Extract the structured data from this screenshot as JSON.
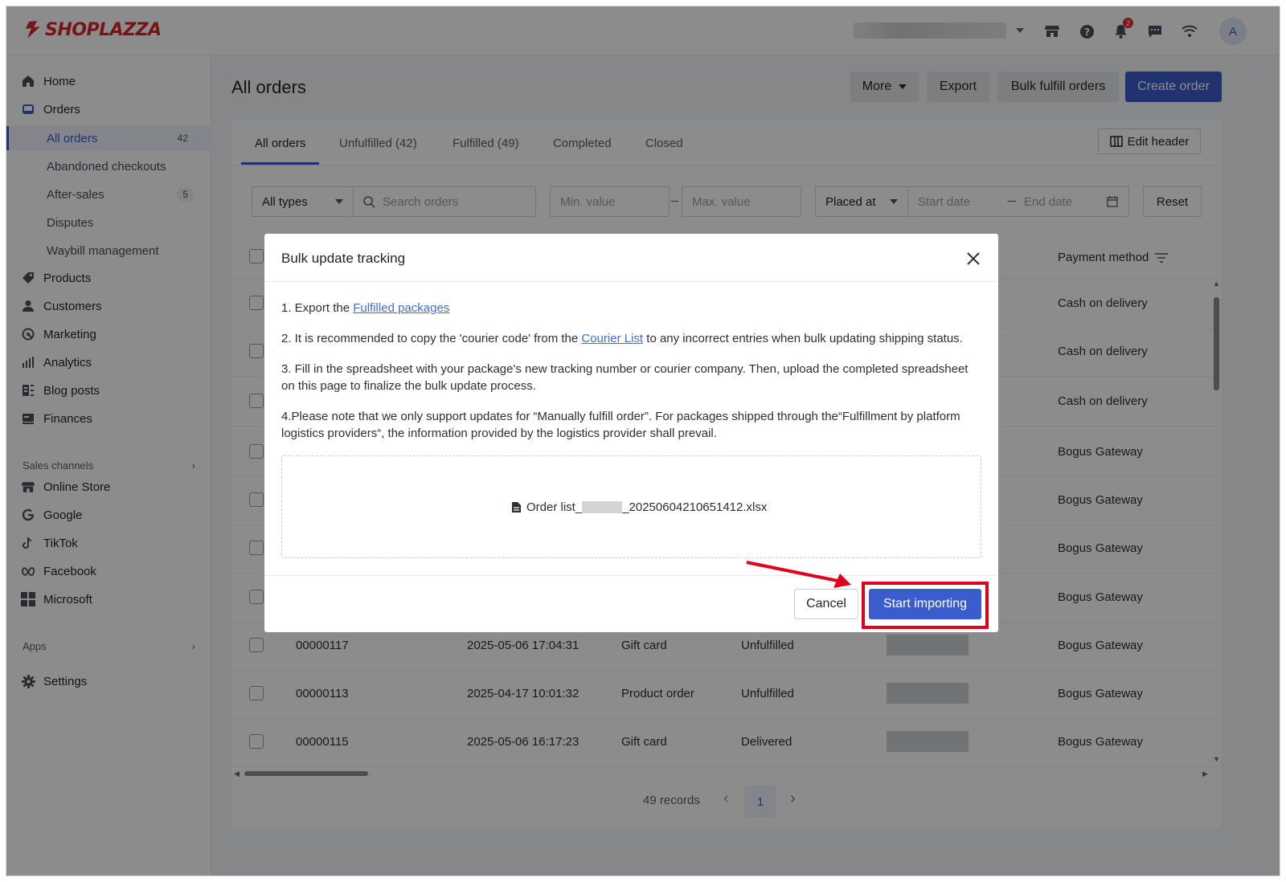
{
  "brand": {
    "name": "SHOPLAZZA",
    "color": "#d7262c",
    "accent": "#3b5ccc"
  },
  "topbar": {
    "icons": [
      "store-icon",
      "help-icon",
      "bell-icon",
      "chat-icon",
      "wifi-icon"
    ],
    "notification_count": "2",
    "avatar_letter": "A"
  },
  "sidebar": {
    "items": [
      {
        "label": "Home",
        "icon": "home-icon"
      },
      {
        "label": "Orders",
        "icon": "orders-icon"
      },
      {
        "label": "Products",
        "icon": "tag-icon"
      },
      {
        "label": "Customers",
        "icon": "user-icon"
      },
      {
        "label": "Marketing",
        "icon": "marketing-icon"
      },
      {
        "label": "Analytics",
        "icon": "bar-chart-icon"
      },
      {
        "label": "Blog posts",
        "icon": "blog-icon"
      },
      {
        "label": "Finances",
        "icon": "finance-icon"
      }
    ],
    "order_subitems": [
      {
        "label": "All orders",
        "count": "42"
      },
      {
        "label": "Abandoned checkouts",
        "count": ""
      },
      {
        "label": "After-sales",
        "count": "5"
      },
      {
        "label": "Disputes",
        "count": ""
      },
      {
        "label": "Waybill management",
        "count": ""
      }
    ],
    "sales_channels_label": "Sales channels",
    "channels": [
      {
        "label": "Online Store",
        "icon": "store-icon"
      },
      {
        "label": "Google",
        "icon": "google-icon"
      },
      {
        "label": "TikTok",
        "icon": "tiktok-icon"
      },
      {
        "label": "Facebook",
        "icon": "meta-icon"
      },
      {
        "label": "Microsoft",
        "icon": "microsoft-icon"
      }
    ],
    "apps_label": "Apps",
    "settings_label": "Settings"
  },
  "main": {
    "title": "All orders",
    "buttons": {
      "more": "More",
      "export": "Export",
      "bulk_fulfill": "Bulk fulfill orders",
      "create": "Create order"
    },
    "tabs": [
      "All orders",
      "Unfulfilled (42)",
      "Fulfilled (49)",
      "Completed",
      "Closed"
    ],
    "edit_header": "Edit header",
    "filters": {
      "type": "All types",
      "search_placeholder": "Search orders",
      "min_placeholder": "Min. value",
      "max_placeholder": "Max. value",
      "date_field": "Placed at",
      "start_placeholder": "Start date",
      "end_placeholder": "End date",
      "reset": "Reset"
    },
    "payment_header": "Payment method",
    "rows": [
      {
        "id": "",
        "date": "",
        "type": "",
        "status": "",
        "payment": "Cash on delivery"
      },
      {
        "id": "",
        "date": "",
        "type": "",
        "status": "",
        "payment": "Cash on delivery"
      },
      {
        "id": "",
        "date": "",
        "type": "",
        "status": "",
        "payment": "Cash on delivery"
      },
      {
        "id": "",
        "date": "",
        "type": "",
        "status": "",
        "payment": "Bogus Gateway"
      },
      {
        "id": "",
        "date": "",
        "type": "",
        "status": "",
        "payment": "Bogus Gateway"
      },
      {
        "id": "",
        "date": "",
        "type": "",
        "status": "",
        "payment": "Bogus Gateway"
      },
      {
        "id": "",
        "date": "",
        "type": "",
        "status": "",
        "payment": "Bogus Gateway"
      },
      {
        "id": "00000117",
        "date": "2025-05-06 17:04:31",
        "type": "Gift card",
        "status": "Unfulfilled",
        "payment": "Bogus Gateway"
      },
      {
        "id": "00000113",
        "date": "2025-04-17 10:01:32",
        "type": "Product order",
        "status": "Unfulfilled",
        "payment": "Bogus Gateway"
      },
      {
        "id": "00000115",
        "date": "2025-05-06 16:17:23",
        "type": "Gift card",
        "status": "Delivered",
        "payment": "Bogus Gateway"
      }
    ],
    "pagination": {
      "records": "49 records",
      "current_page": "1"
    }
  },
  "modal": {
    "title": "Bulk update tracking",
    "step1_prefix": "1. Export the ",
    "step1_link": "Fulfilled packages",
    "step2_prefix": "2. It is recommended to copy the 'courier code' from the ",
    "step2_link": "Courier List",
    "step2_suffix": " to any incorrect entries when bulk updating shipping status.",
    "step3": "3. Fill in the spreadsheet with your package's new tracking number or courier company. Then, upload the completed spreadsheet on this page to finalize the bulk update process.",
    "step4": "4.Please note that we only support updates for “Manually fulfill order”. For packages shipped through the“Fulfillment by platform logistics providers“, the information provided by the logistics provider shall prevail.",
    "file_prefix": "Order list_",
    "file_suffix": "_20250604210651412.xlsx",
    "cancel": "Cancel",
    "start": "Start importing",
    "highlight_color": "#e0001b"
  }
}
